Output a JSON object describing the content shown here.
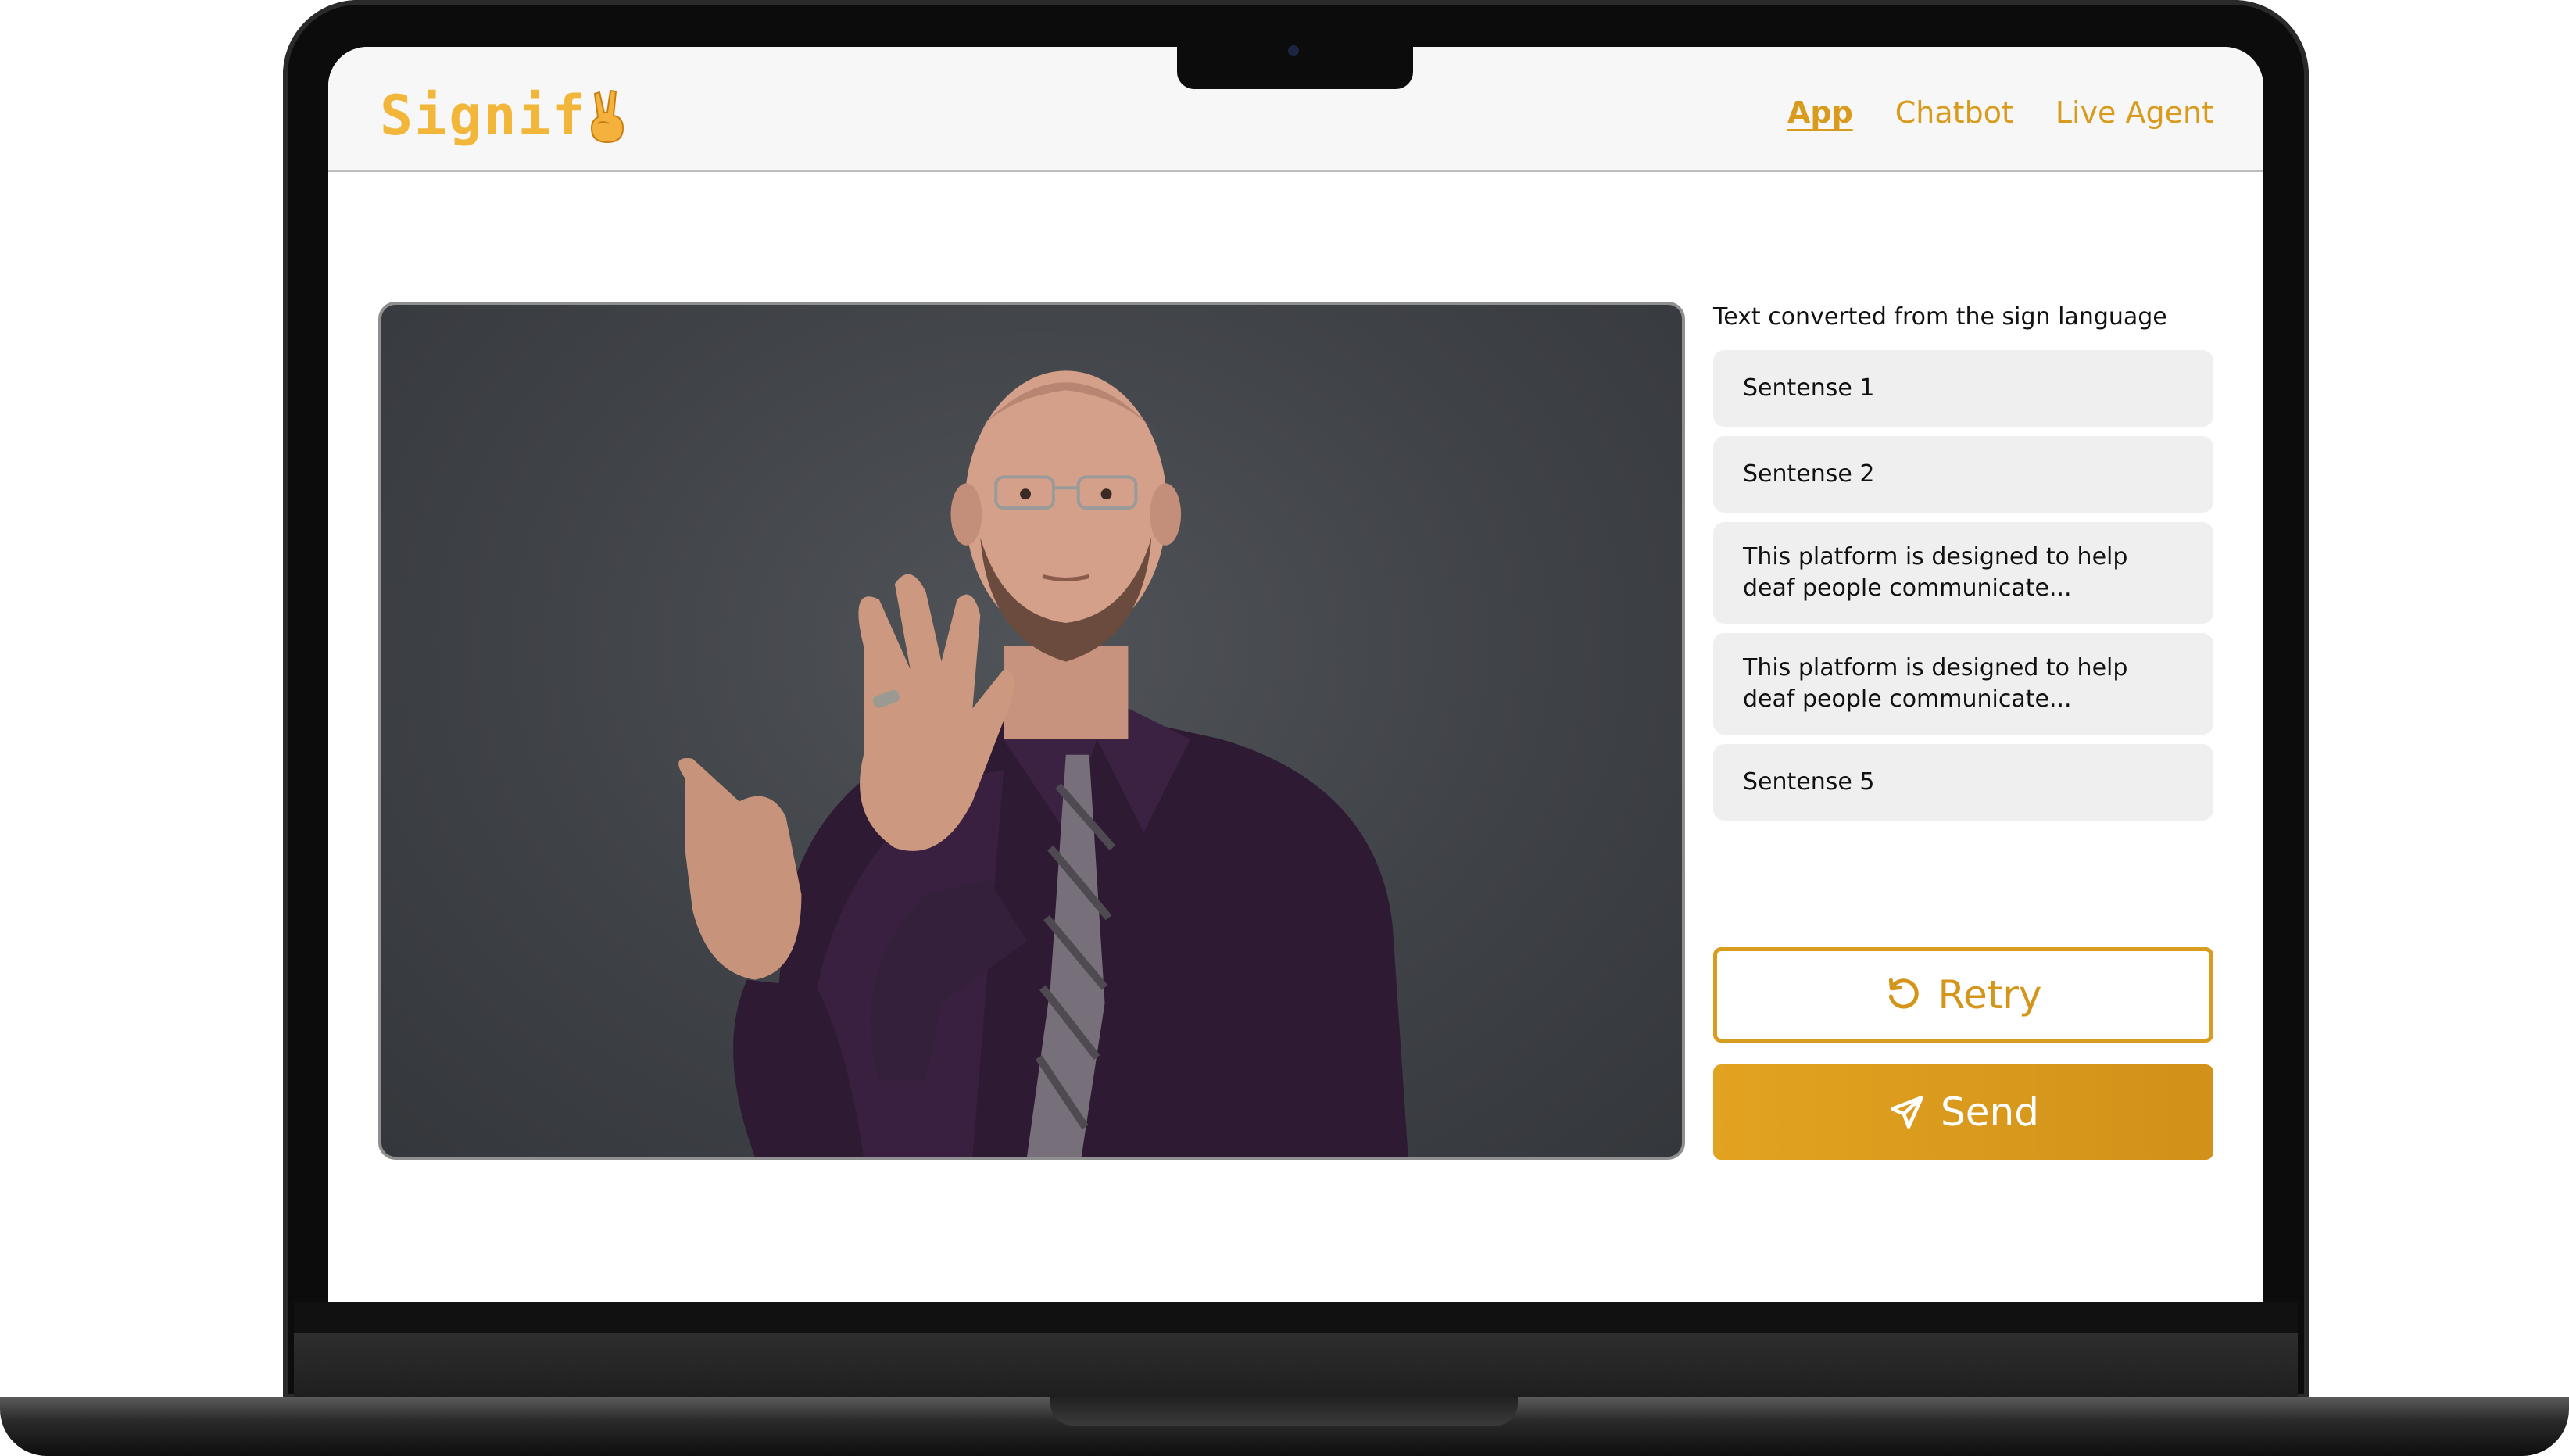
{
  "app": {
    "logo_text": "Signif",
    "logo_emoji": "victory-hand-emoji",
    "accent_color": "#d99b1e"
  },
  "nav": {
    "items": [
      {
        "label": "App",
        "active": true
      },
      {
        "label": "Chatbot",
        "active": false
      },
      {
        "label": "Live Agent",
        "active": false
      }
    ]
  },
  "main": {
    "video": {
      "content": "sign-language-interpreter-video"
    },
    "panel_caption": "Text converted from the sign language",
    "sentences": [
      "Sentense 1",
      "Sentense 2",
      "This platform is designed to help deaf people communicate...",
      "This platform is designed to help deaf people communicate...",
      "Sentense 5"
    ],
    "retry_label": "Retry",
    "send_label": "Send"
  }
}
